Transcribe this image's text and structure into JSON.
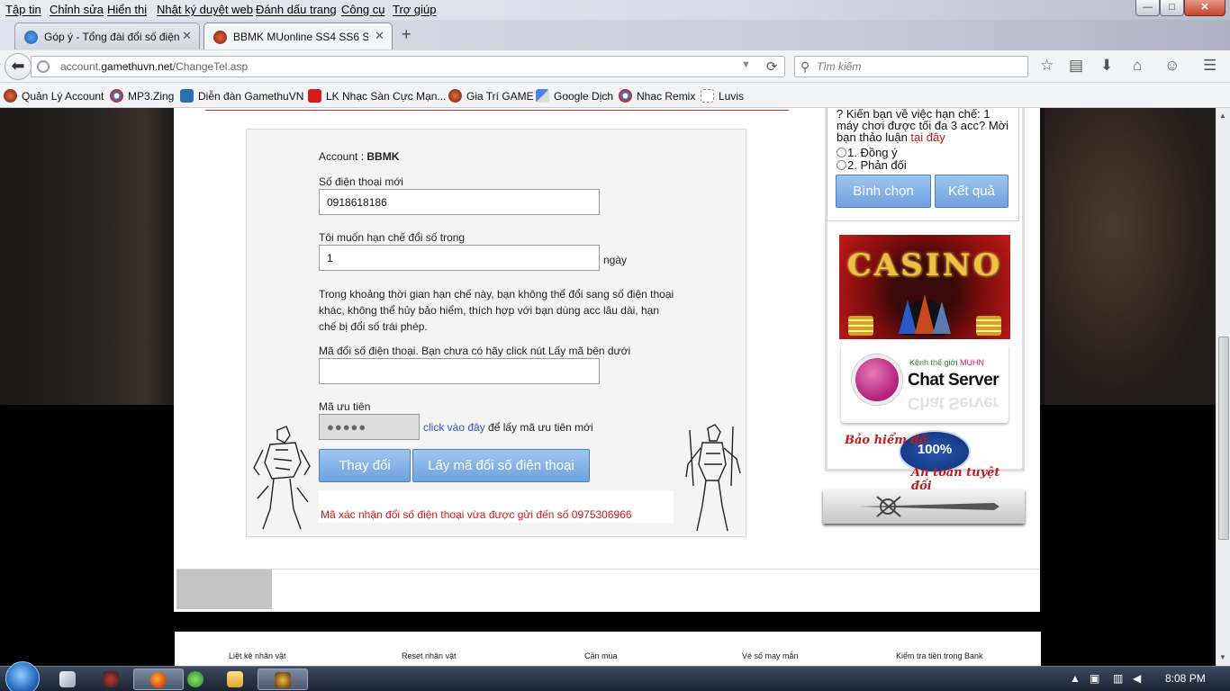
{
  "menu": [
    "Tập tin",
    "Chỉnh sửa",
    "Hiển thị",
    "Nhật ký duyệt web",
    "Đánh dấu trang",
    "Công cụ",
    "Trợ giúp"
  ],
  "window_controls": {
    "minimize": "—",
    "maximize": "□",
    "close": "✕"
  },
  "tabs": [
    {
      "label": "Góp ý - Tổng đài đổi số điện...",
      "active": false
    },
    {
      "label": "BBMK MUonline SS4 SS6 S...",
      "active": true
    }
  ],
  "tab_close": "✕",
  "new_tab": "+",
  "nav": {
    "url_domain": "account.gamethuvn.net",
    "url_path": "/ChangeTel.asp",
    "url_prefix": "account.",
    "url_host": "gamethuvn.net",
    "search_placeholder": "Tìm kiếm"
  },
  "bookmarks": [
    {
      "label": "Quản Lý Account",
      "color": "#8a1f1f"
    },
    {
      "label": "MP3.Zing",
      "color": "#3a7bd5"
    },
    {
      "label": "Diễn đàn GamethuVN",
      "color": "#2a6fb0"
    },
    {
      "label": "LK Nhạc Sàn Cực Mạn...",
      "color": "#d41c1c"
    },
    {
      "label": "Gia Trí GAME",
      "color": "#8a1f1f"
    },
    {
      "label": "Google Dịch",
      "color": "#4a86e8"
    },
    {
      "label": "Nhac Remix",
      "color": "#3a7bd5"
    },
    {
      "label": "Luvis",
      "color": "#ffffff"
    }
  ],
  "form": {
    "account_label": "Account : ",
    "account_value": "BBMK",
    "new_phone_label": "Số điện thoại mới",
    "new_phone_value": "0918618186",
    "limit_label": "Tôi muốn hạn chế đổi số trong",
    "limit_value": "1",
    "limit_unit": "ngày",
    "description": "Trong khoảng thời gian hạn chế này, bạn không thể đổi sang số điện thoại khác, không thể hủy bảo hiểm, thích hợp với bạn dùng acc lâu dài, hạn chế bị đổi số trái phép.",
    "code_label": "Mã đổi số điện thoại. Bạn chưa có hãy click nút Lấy mã bên dưới",
    "code_value": "",
    "priority_label": "Mã ưu tiên",
    "priority_value": "●●●●●",
    "priority_link": "click vào đây",
    "priority_suffix": " để lấy mã ưu tiên mới",
    "btn_change": "Thay đổi",
    "btn_get_code": "Lấy mã đổi số điện thoại",
    "message": "Mã xác nhận đổi số điện thoại vừa được gửi đến số 0975306966"
  },
  "poll": {
    "question": "? Kiến bạn về việc hạn chế: 1 máy chơi được tối đa 3 acc? Mời bạn thảo luận ",
    "question_link": "tại đây",
    "option1": "1. Đồng ý",
    "option2": "2. Phản đối",
    "btn_vote": "Bình chọn",
    "btn_result": "Kết quả"
  },
  "ads": {
    "casino": "CASINO",
    "chat_sub_prefix": "Kênh thế giới ",
    "chat_sub_brand": "MUHN",
    "chat_title": "Chat Server",
    "insurance_top": "Bảo hiểm đồ",
    "insurance_seal": "100%",
    "insurance_bottom": "An toàn tuyệt đối"
  },
  "footer_links": [
    "Liệt kê nhân vật",
    "Reset nhân vật",
    "Cần mua",
    "Vé số may mắn",
    "Kiểm tra tiền trong Bank"
  ],
  "taskbar": {
    "clock": "8:08 PM"
  }
}
